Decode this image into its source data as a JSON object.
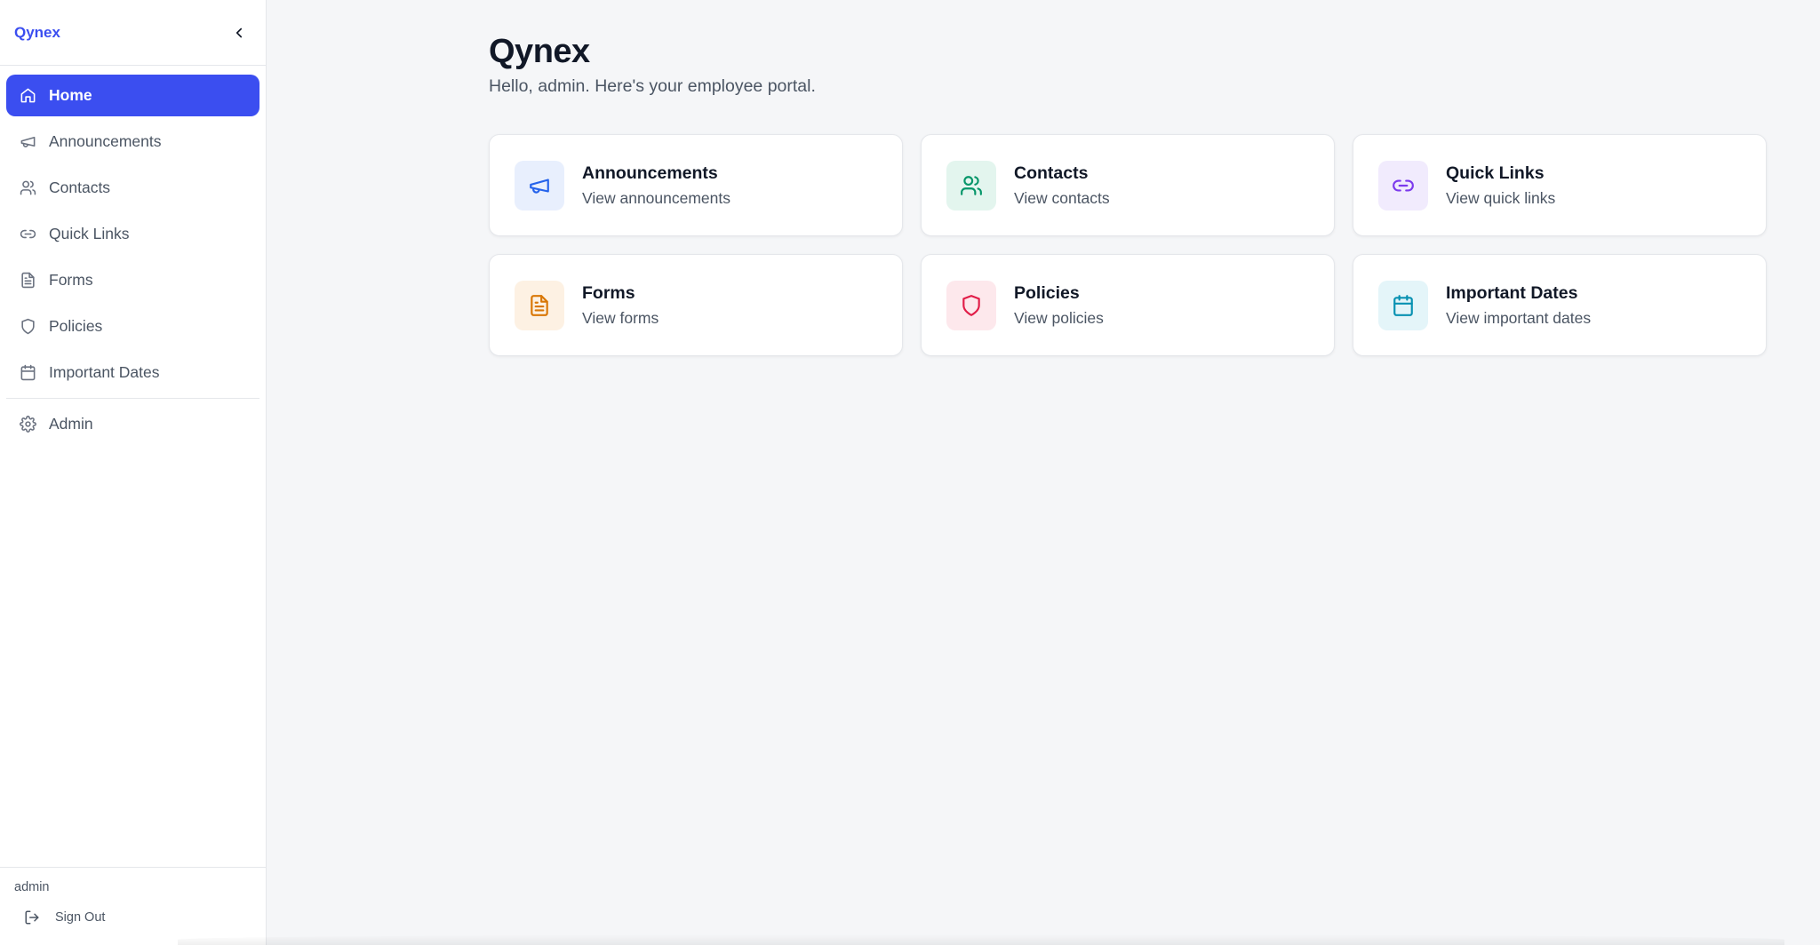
{
  "app": {
    "brand": "Qynex"
  },
  "sidebar": {
    "items": [
      {
        "label": "Home",
        "icon": "home-icon",
        "active": true
      },
      {
        "label": "Announcements",
        "icon": "megaphone-icon"
      },
      {
        "label": "Contacts",
        "icon": "users-icon"
      },
      {
        "label": "Quick Links",
        "icon": "link-icon"
      },
      {
        "label": "Forms",
        "icon": "file-text-icon"
      },
      {
        "label": "Policies",
        "icon": "shield-icon"
      },
      {
        "label": "Important Dates",
        "icon": "calendar-icon"
      }
    ],
    "admin": {
      "label": "Admin",
      "icon": "gear-icon"
    },
    "footer": {
      "user": "admin",
      "signout_label": "Sign Out"
    }
  },
  "main": {
    "title": "Qynex",
    "subtitle": "Hello, admin. Here's your employee portal.",
    "cards": [
      {
        "title": "Announcements",
        "desc": "View announcements",
        "icon": "megaphone-icon",
        "color": "#2563eb",
        "bg": "#e8effd"
      },
      {
        "title": "Contacts",
        "desc": "View contacts",
        "icon": "users-icon",
        "color": "#059669",
        "bg": "#e3f5ee"
      },
      {
        "title": "Quick Links",
        "desc": "View quick links",
        "icon": "link-icon",
        "color": "#7c3aed",
        "bg": "#f1ebfd"
      },
      {
        "title": "Forms",
        "desc": "View forms",
        "icon": "file-text-icon",
        "color": "#d97706",
        "bg": "#fdf1e3"
      },
      {
        "title": "Policies",
        "desc": "View policies",
        "icon": "shield-icon",
        "color": "#e11d48",
        "bg": "#fde8ec"
      },
      {
        "title": "Important Dates",
        "desc": "View important dates",
        "icon": "calendar-icon",
        "color": "#0891b2",
        "bg": "#e4f5f9"
      }
    ]
  }
}
